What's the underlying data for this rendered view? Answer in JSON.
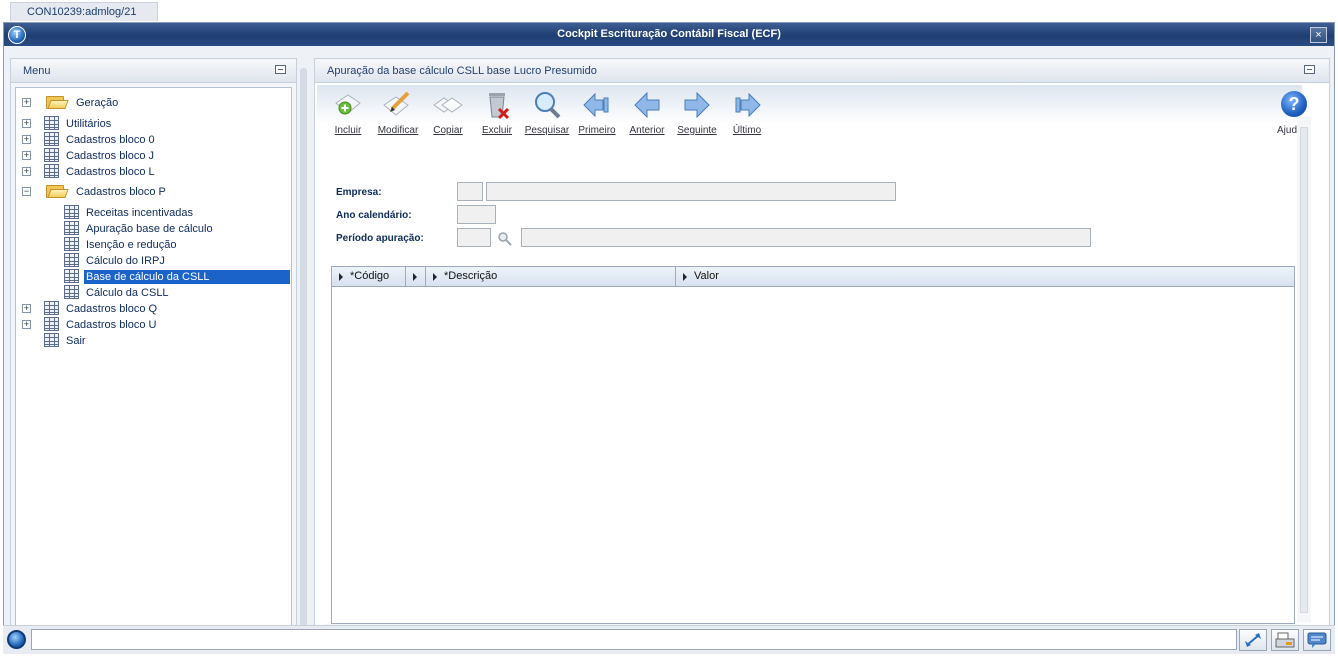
{
  "tab": {
    "label": "CON10239:admlog/21"
  },
  "window": {
    "title": "Cockpit Escrituração Contábil Fiscal (ECF)",
    "close": "×"
  },
  "menu": {
    "title": "Menu",
    "items": [
      {
        "label": "Geração",
        "type": "folder",
        "expander": "+",
        "level": 0
      },
      {
        "label": "Utilitários",
        "type": "grid",
        "expander": "+",
        "level": 0
      },
      {
        "label": "Cadastros bloco 0",
        "type": "grid",
        "expander": "+",
        "level": 0
      },
      {
        "label": "Cadastros bloco J",
        "type": "grid",
        "expander": "+",
        "level": 0
      },
      {
        "label": "Cadastros bloco L",
        "type": "grid",
        "expander": "+",
        "level": 0
      },
      {
        "label": "Cadastros bloco P",
        "type": "folder-open",
        "expander": "−",
        "level": 0
      },
      {
        "label": "Receitas incentivadas",
        "type": "grid",
        "level": 1
      },
      {
        "label": "Apuração base de cálculo",
        "type": "grid",
        "level": 1
      },
      {
        "label": "Isenção e redução",
        "type": "grid",
        "level": 1
      },
      {
        "label": "Cálculo do IRPJ",
        "type": "grid",
        "level": 1
      },
      {
        "label": "Base de cálculo da CSLL",
        "type": "grid",
        "level": 1,
        "selected": true
      },
      {
        "label": "Cálculo da CSLL",
        "type": "grid",
        "level": 1
      },
      {
        "label": "Cadastros bloco Q",
        "type": "grid",
        "expander": "+",
        "level": 0
      },
      {
        "label": "Cadastros bloco U",
        "type": "grid",
        "expander": "+",
        "level": 0
      },
      {
        "label": "Sair",
        "type": "grid",
        "level": 0
      }
    ]
  },
  "content": {
    "title": "Apuração da base cálculo CSLL base Lucro Presumido",
    "toolbar": [
      {
        "label": "Incluir",
        "icon": "add-document-icon"
      },
      {
        "label": "Modificar",
        "icon": "edit-pencil-icon"
      },
      {
        "label": "Copiar",
        "icon": "copy-documents-icon"
      },
      {
        "label": "Excluir",
        "icon": "trash-delete-icon"
      },
      {
        "label": "Pesquisar",
        "icon": "magnifier-icon"
      },
      {
        "label": "Primeiro",
        "icon": "first-arrow-icon"
      },
      {
        "label": "Anterior",
        "icon": "previous-arrow-icon"
      },
      {
        "label": "Seguinte",
        "icon": "next-arrow-icon"
      },
      {
        "label": "Último",
        "icon": "last-arrow-icon"
      }
    ],
    "help": {
      "label": "Ajuda",
      "glyph": "?"
    },
    "form": {
      "empresa_label": "Empresa:",
      "ano_label": "Ano calendário:",
      "periodo_label": "Período apuração:"
    },
    "grid": {
      "columns": [
        "*Código",
        "*Descrição",
        "Valor"
      ]
    }
  },
  "colors": {
    "title_bar": "#1f3e73",
    "selection": "#1b63c8",
    "text": "#0d2b5a"
  }
}
